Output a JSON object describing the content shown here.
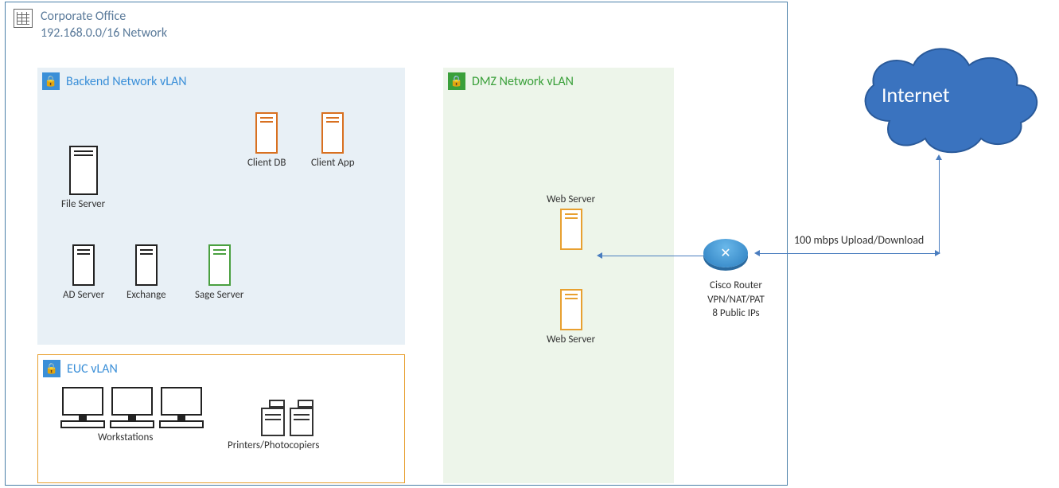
{
  "corporate": {
    "title1": "Corporate Office",
    "title2": "192.168.0.0/16 Network"
  },
  "backend": {
    "title": "Backend Network vLAN",
    "servers": {
      "file": "File Server",
      "clientdb": "Client DB",
      "clientapp": "Client App",
      "ad": "AD Server",
      "exchange": "Exchange",
      "sage": "Sage Server"
    }
  },
  "euc": {
    "title": "EUC vLAN",
    "workstations": "Workstations",
    "printers": "Printers/Photocopiers"
  },
  "dmz": {
    "title": "DMZ Network vLAN",
    "web1": "Web Server",
    "web2": "Web Server"
  },
  "router": {
    "name": "Cisco Router",
    "line2": "VPN/NAT/PAT",
    "line3": "8 Public IPs"
  },
  "internet": "Internet",
  "link": "100 mbps Upload/Download"
}
